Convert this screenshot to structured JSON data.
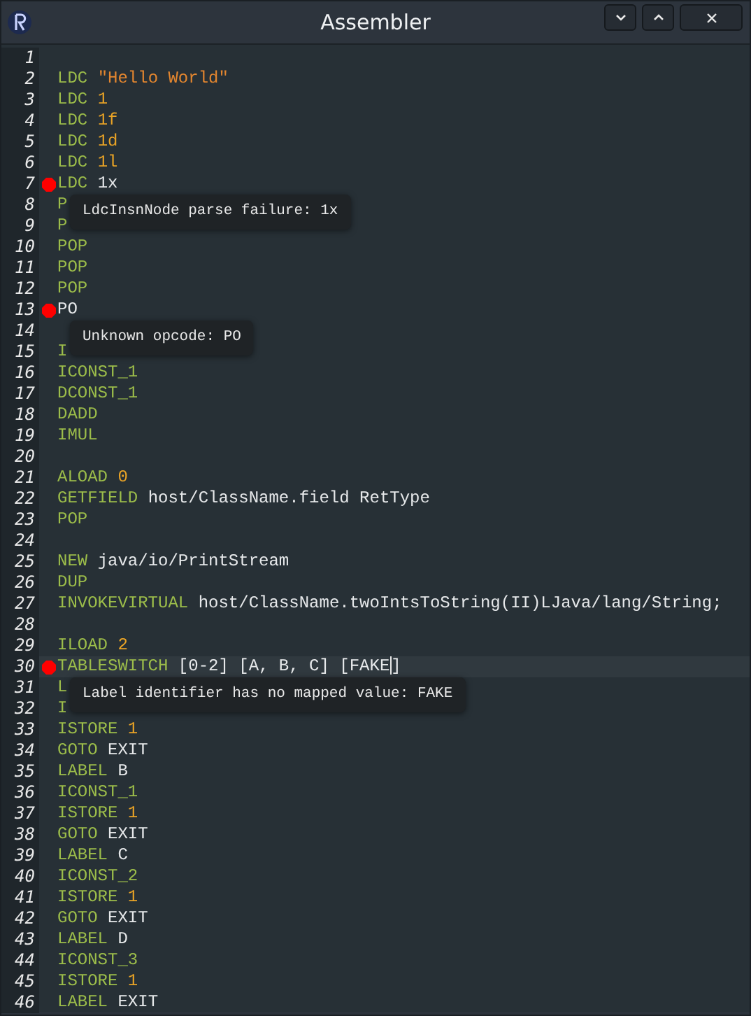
{
  "window": {
    "title": "Assembler"
  },
  "lines": [
    {
      "number": "1",
      "error": false,
      "highlighted": false
    },
    {
      "number": "2",
      "error": false,
      "highlighted": false,
      "tokens": [
        {
          "kind": "op",
          "text": "LDC"
        },
        {
          "kind": "string",
          "text": "\"Hello World\""
        }
      ]
    },
    {
      "number": "3",
      "error": false,
      "highlighted": false,
      "tokens": [
        {
          "kind": "op",
          "text": "LDC"
        },
        {
          "kind": "number",
          "text": "1"
        }
      ]
    },
    {
      "number": "4",
      "error": false,
      "highlighted": false,
      "tokens": [
        {
          "kind": "op",
          "text": "LDC"
        },
        {
          "kind": "number",
          "text": "1f"
        }
      ]
    },
    {
      "number": "5",
      "error": false,
      "highlighted": false,
      "tokens": [
        {
          "kind": "op",
          "text": "LDC"
        },
        {
          "kind": "number",
          "text": "1d"
        }
      ]
    },
    {
      "number": "6",
      "error": false,
      "highlighted": false,
      "tokens": [
        {
          "kind": "op",
          "text": "LDC"
        },
        {
          "kind": "number",
          "text": "1l"
        }
      ]
    },
    {
      "number": "7",
      "error": true,
      "highlighted": false,
      "tokens": [
        {
          "kind": "op",
          "text": "LDC"
        },
        {
          "kind": "plain",
          "text": "1x"
        }
      ],
      "tooltip": "LdcInsnNode parse failure: 1x"
    },
    {
      "number": "8",
      "error": false,
      "highlighted": false,
      "tokens": [
        {
          "kind": "op",
          "text": "P"
        }
      ]
    },
    {
      "number": "9",
      "error": false,
      "highlighted": false,
      "tokens": [
        {
          "kind": "op",
          "text": "P"
        }
      ]
    },
    {
      "number": "10",
      "error": false,
      "highlighted": false,
      "tokens": [
        {
          "kind": "op",
          "text": "POP"
        }
      ]
    },
    {
      "number": "11",
      "error": false,
      "highlighted": false,
      "tokens": [
        {
          "kind": "op",
          "text": "POP"
        }
      ]
    },
    {
      "number": "12",
      "error": false,
      "highlighted": false,
      "tokens": [
        {
          "kind": "op",
          "text": "POP"
        }
      ]
    },
    {
      "number": "13",
      "error": true,
      "highlighted": false,
      "tokens": [
        {
          "kind": "plain",
          "text": "PO"
        }
      ],
      "tooltip": "Unknown opcode: PO"
    },
    {
      "number": "14",
      "error": false,
      "highlighted": false
    },
    {
      "number": "15",
      "error": false,
      "highlighted": false,
      "tokens": [
        {
          "kind": "op",
          "text": "I"
        }
      ]
    },
    {
      "number": "16",
      "error": false,
      "highlighted": false,
      "tokens": [
        {
          "kind": "op",
          "text": "ICONST_1"
        }
      ]
    },
    {
      "number": "17",
      "error": false,
      "highlighted": false,
      "tokens": [
        {
          "kind": "op",
          "text": "DCONST_1"
        }
      ]
    },
    {
      "number": "18",
      "error": false,
      "highlighted": false,
      "tokens": [
        {
          "kind": "op",
          "text": "DADD"
        }
      ]
    },
    {
      "number": "19",
      "error": false,
      "highlighted": false,
      "tokens": [
        {
          "kind": "op",
          "text": "IMUL"
        }
      ]
    },
    {
      "number": "20",
      "error": false,
      "highlighted": false
    },
    {
      "number": "21",
      "error": false,
      "highlighted": false,
      "tokens": [
        {
          "kind": "op",
          "text": "ALOAD"
        },
        {
          "kind": "number",
          "text": "0"
        }
      ]
    },
    {
      "number": "22",
      "error": false,
      "highlighted": false,
      "tokens": [
        {
          "kind": "op",
          "text": "GETFIELD"
        },
        {
          "kind": "plain",
          "text": "host/ClassName.field RetType"
        }
      ]
    },
    {
      "number": "23",
      "error": false,
      "highlighted": false,
      "tokens": [
        {
          "kind": "op",
          "text": "POP"
        }
      ]
    },
    {
      "number": "24",
      "error": false,
      "highlighted": false
    },
    {
      "number": "25",
      "error": false,
      "highlighted": false,
      "tokens": [
        {
          "kind": "op",
          "text": "NEW"
        },
        {
          "kind": "plain",
          "text": "java/io/PrintStream"
        }
      ]
    },
    {
      "number": "26",
      "error": false,
      "highlighted": false,
      "tokens": [
        {
          "kind": "op",
          "text": "DUP"
        }
      ]
    },
    {
      "number": "27",
      "error": false,
      "highlighted": false,
      "tokens": [
        {
          "kind": "op",
          "text": "INVOKEVIRTUAL"
        },
        {
          "kind": "plain",
          "text": "host/ClassName.twoIntsToString(II)LJava/lang/String;"
        }
      ]
    },
    {
      "number": "28",
      "error": false,
      "highlighted": false
    },
    {
      "number": "29",
      "error": false,
      "highlighted": false,
      "tokens": [
        {
          "kind": "op",
          "text": "ILOAD"
        },
        {
          "kind": "number",
          "text": "2"
        }
      ]
    },
    {
      "number": "30",
      "error": true,
      "highlighted": true,
      "tokens": [
        {
          "kind": "op",
          "text": "TABLESWITCH"
        },
        {
          "kind": "plain",
          "text": "[0-2] [A, B, C] [FAKE]"
        }
      ],
      "tooltip": "Label identifier has no mapped value: FAKE"
    },
    {
      "number": "31",
      "error": false,
      "highlighted": false,
      "tokens": [
        {
          "kind": "op",
          "text": "L"
        }
      ]
    },
    {
      "number": "32",
      "error": false,
      "highlighted": false,
      "tokens": [
        {
          "kind": "op",
          "text": "I"
        }
      ]
    },
    {
      "number": "33",
      "error": false,
      "highlighted": false,
      "tokens": [
        {
          "kind": "op",
          "text": "ISTORE"
        },
        {
          "kind": "number",
          "text": "1"
        }
      ]
    },
    {
      "number": "34",
      "error": false,
      "highlighted": false,
      "tokens": [
        {
          "kind": "op",
          "text": "GOTO"
        },
        {
          "kind": "plain",
          "text": "EXIT"
        }
      ]
    },
    {
      "number": "35",
      "error": false,
      "highlighted": false,
      "tokens": [
        {
          "kind": "op",
          "text": "LABEL"
        },
        {
          "kind": "plain",
          "text": "B"
        }
      ]
    },
    {
      "number": "36",
      "error": false,
      "highlighted": false,
      "tokens": [
        {
          "kind": "op",
          "text": "ICONST_1"
        }
      ]
    },
    {
      "number": "37",
      "error": false,
      "highlighted": false,
      "tokens": [
        {
          "kind": "op",
          "text": "ISTORE"
        },
        {
          "kind": "number",
          "text": "1"
        }
      ]
    },
    {
      "number": "38",
      "error": false,
      "highlighted": false,
      "tokens": [
        {
          "kind": "op",
          "text": "GOTO"
        },
        {
          "kind": "plain",
          "text": "EXIT"
        }
      ]
    },
    {
      "number": "39",
      "error": false,
      "highlighted": false,
      "tokens": [
        {
          "kind": "op",
          "text": "LABEL"
        },
        {
          "kind": "plain",
          "text": "C"
        }
      ]
    },
    {
      "number": "40",
      "error": false,
      "highlighted": false,
      "tokens": [
        {
          "kind": "op",
          "text": "ICONST_2"
        }
      ]
    },
    {
      "number": "41",
      "error": false,
      "highlighted": false,
      "tokens": [
        {
          "kind": "op",
          "text": "ISTORE"
        },
        {
          "kind": "number",
          "text": "1"
        }
      ]
    },
    {
      "number": "42",
      "error": false,
      "highlighted": false,
      "tokens": [
        {
          "kind": "op",
          "text": "GOTO"
        },
        {
          "kind": "plain",
          "text": "EXIT"
        }
      ]
    },
    {
      "number": "43",
      "error": false,
      "highlighted": false,
      "tokens": [
        {
          "kind": "op",
          "text": "LABEL"
        },
        {
          "kind": "plain",
          "text": "D"
        }
      ]
    },
    {
      "number": "44",
      "error": false,
      "highlighted": false,
      "tokens": [
        {
          "kind": "op",
          "text": "ICONST_3"
        }
      ]
    },
    {
      "number": "45",
      "error": false,
      "highlighted": false,
      "tokens": [
        {
          "kind": "op",
          "text": "ISTORE"
        },
        {
          "kind": "number",
          "text": "1"
        }
      ]
    },
    {
      "number": "46",
      "error": false,
      "highlighted": false,
      "tokens": [
        {
          "kind": "op",
          "text": "LABEL"
        },
        {
          "kind": "plain",
          "text": "EXIT"
        }
      ]
    }
  ]
}
